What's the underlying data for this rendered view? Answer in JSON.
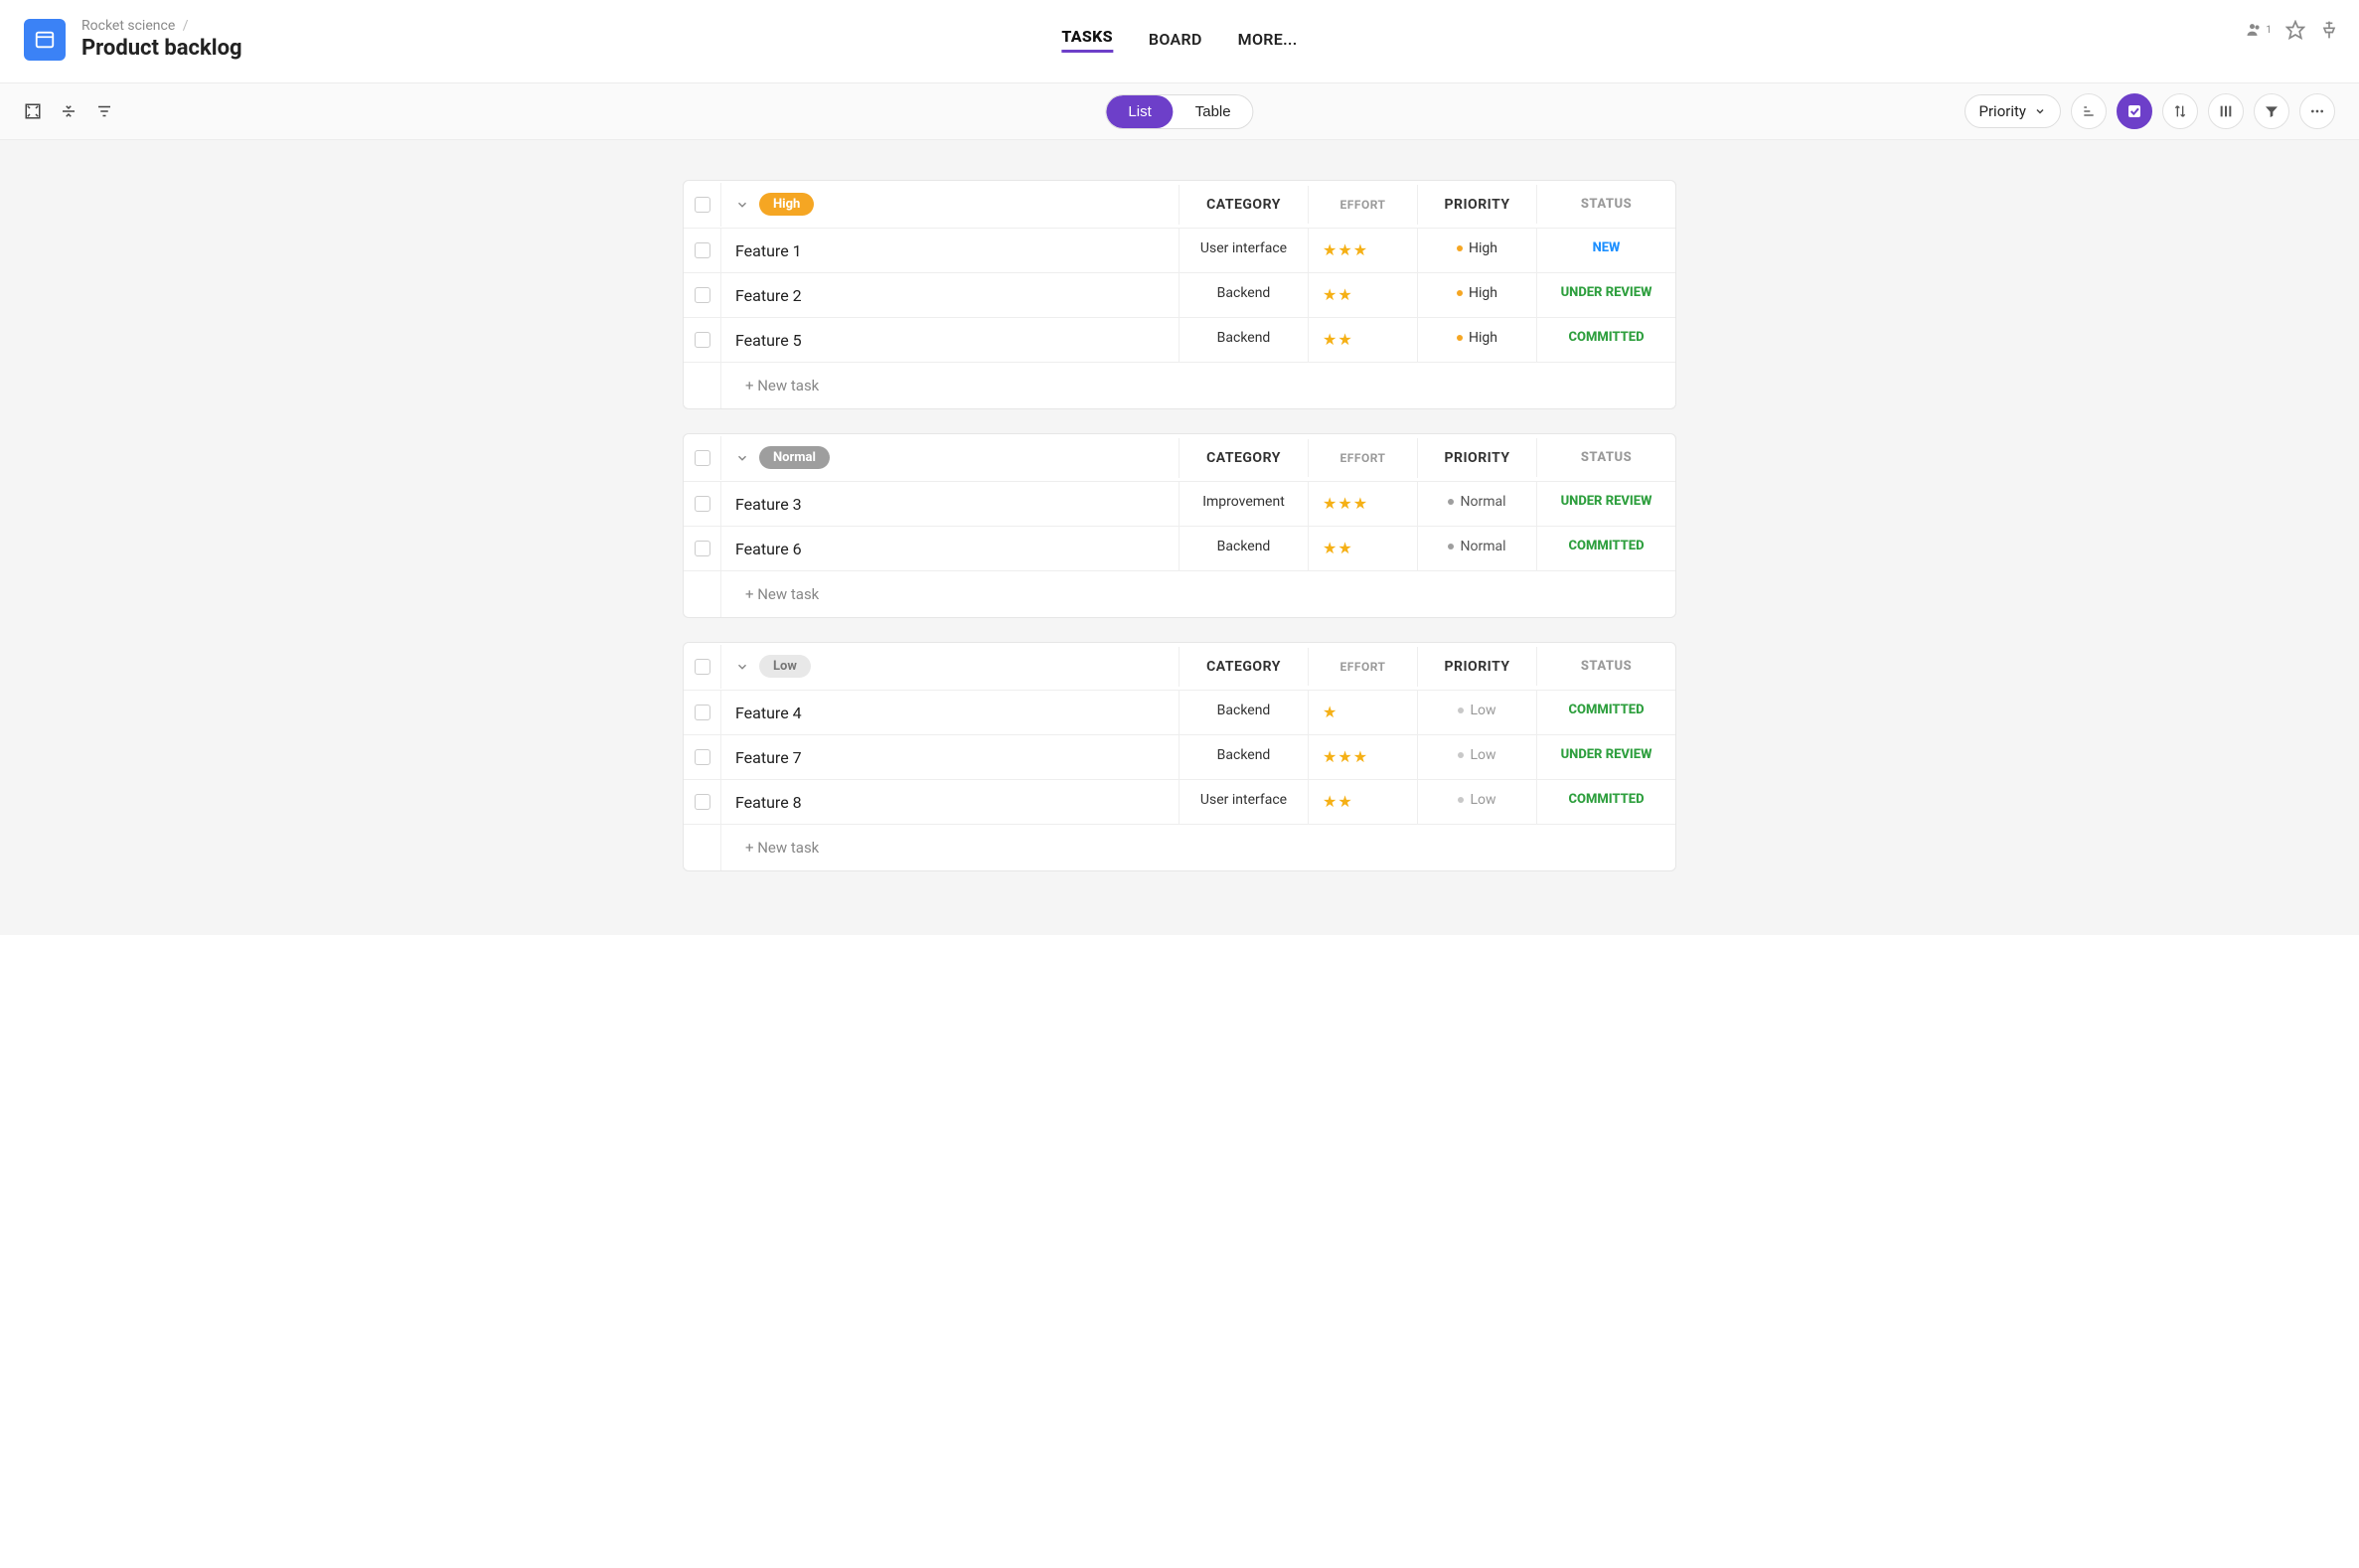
{
  "breadcrumb": {
    "parent": "Rocket science",
    "sep": "/"
  },
  "page_title": "Product backlog",
  "tabs": {
    "tasks": "TASKS",
    "board": "BOARD",
    "more": "MORE..."
  },
  "header_actions": {
    "people_count": "1"
  },
  "toolbar": {
    "view_list": "List",
    "view_table": "Table",
    "group_by_label": "Priority"
  },
  "columns": {
    "category": "CATEGORY",
    "effort": "EFFORT",
    "priority": "PRIORITY",
    "status": "STATUS"
  },
  "new_task_label": "+ New task",
  "groups": [
    {
      "name": "High",
      "pill_class": "pill-high",
      "rows": [
        {
          "title": "Feature 1",
          "category": "User interface",
          "effort": 3,
          "priority": "High",
          "priority_class": "pri-high",
          "status": "NEW",
          "status_class": "st-new"
        },
        {
          "title": "Feature 2",
          "category": "Backend",
          "effort": 2,
          "priority": "High",
          "priority_class": "pri-high",
          "status": "UNDER REVIEW",
          "status_class": "st-green"
        },
        {
          "title": "Feature 5",
          "category": "Backend",
          "effort": 2,
          "priority": "High",
          "priority_class": "pri-high",
          "status": "COMMITTED",
          "status_class": "st-green"
        }
      ]
    },
    {
      "name": "Normal",
      "pill_class": "pill-normal",
      "rows": [
        {
          "title": "Feature 3",
          "category": "Improvement",
          "effort": 3,
          "priority": "Normal",
          "priority_class": "pri-normal",
          "status": "UNDER REVIEW",
          "status_class": "st-green"
        },
        {
          "title": "Feature 6",
          "category": "Backend",
          "effort": 2,
          "priority": "Normal",
          "priority_class": "pri-normal",
          "status": "COMMITTED",
          "status_class": "st-green"
        }
      ]
    },
    {
      "name": "Low",
      "pill_class": "pill-low",
      "rows": [
        {
          "title": "Feature 4",
          "category": "Backend",
          "effort": 1,
          "priority": "Low",
          "priority_class": "pri-low",
          "status": "COMMITTED",
          "status_class": "st-green"
        },
        {
          "title": "Feature 7",
          "category": "Backend",
          "effort": 3,
          "priority": "Low",
          "priority_class": "pri-low",
          "status": "UNDER REVIEW",
          "status_class": "st-green"
        },
        {
          "title": "Feature 8",
          "category": "User interface",
          "effort": 2,
          "priority": "Low",
          "priority_class": "pri-low",
          "status": "COMMITTED",
          "status_class": "st-green"
        }
      ]
    }
  ]
}
